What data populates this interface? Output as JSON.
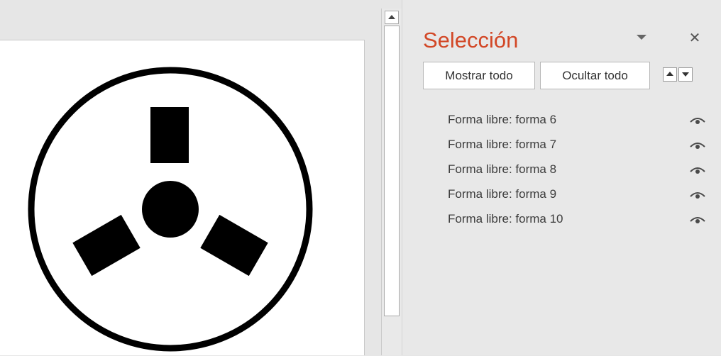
{
  "selection_pane": {
    "title": "Selección",
    "show_all_label": "Mostrar todo",
    "hide_all_label": "Ocultar todo",
    "close_glyph": "✕",
    "items": [
      {
        "label": "Forma libre: forma 6"
      },
      {
        "label": "Forma libre: forma 7"
      },
      {
        "label": "Forma libre: forma 8"
      },
      {
        "label": "Forma libre: forma 9"
      },
      {
        "label": "Forma libre: forma 10"
      }
    ]
  },
  "icons": {
    "visibility": "eye-icon",
    "close": "close-icon",
    "options": "chevron-down-icon",
    "bring_forward": "arrow-up-icon",
    "send_backward": "arrow-down-icon"
  },
  "colors": {
    "title_accent": "#d24726",
    "shape_fill": "#000000",
    "slide_background": "#ffffff",
    "pane_background": "#e8e8e8"
  }
}
